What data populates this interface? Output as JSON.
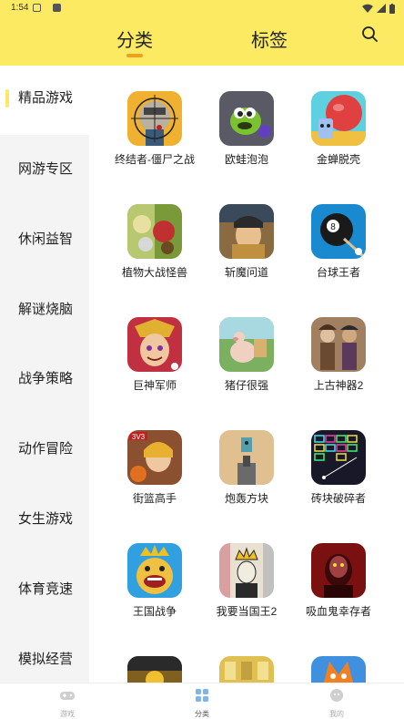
{
  "status": {
    "time": "1:54"
  },
  "header": {
    "tabs": [
      {
        "label": "分类"
      },
      {
        "label": "标签"
      }
    ]
  },
  "sidebar": {
    "items": [
      {
        "label": "精品游戏"
      },
      {
        "label": "网游专区"
      },
      {
        "label": "休闲益智"
      },
      {
        "label": "解谜烧脑"
      },
      {
        "label": "战争策略"
      },
      {
        "label": "动作冒险"
      },
      {
        "label": "女生游戏"
      },
      {
        "label": "体育竞速"
      },
      {
        "label": "模拟经营"
      }
    ]
  },
  "games": [
    {
      "name": "终结者-僵尸之战",
      "icon": "zombie-sniper-icon",
      "color": "#f0b030"
    },
    {
      "name": "欧蛙泡泡",
      "icon": "green-frog-icon",
      "color": "#5a5a66"
    },
    {
      "name": "金蝉脱壳",
      "icon": "ball-run-icon",
      "color": "#5fd0e0"
    },
    {
      "name": "植物大战怪兽",
      "icon": "plants-monsters-icon",
      "color": "#7a9a3a"
    },
    {
      "name": "斩魔问道",
      "icon": "warrior-icon",
      "color": "#8a6a40"
    },
    {
      "name": "台球王者",
      "icon": "billiard-ball-icon",
      "color": "#1a8ad0"
    },
    {
      "name": "巨神军师",
      "icon": "hero-face-icon",
      "color": "#c03040"
    },
    {
      "name": "猪仔很强",
      "icon": "pig-icon",
      "color": "#7ab060"
    },
    {
      "name": "上古神器2",
      "icon": "adventurers-icon",
      "color": "#a08060"
    },
    {
      "name": "街篮高手",
      "icon": "basketball-girl-icon",
      "color": "#8a5030"
    },
    {
      "name": "炮轰方块",
      "icon": "cannon-block-icon",
      "color": "#e0c090"
    },
    {
      "name": "砖块破碎者",
      "icon": "brick-breaker-icon",
      "color": "#181828"
    },
    {
      "name": "王国战争",
      "icon": "king-face-icon",
      "color": "#30a0e0"
    },
    {
      "name": "我要当国王2",
      "icon": "crown-king-icon",
      "color": "#e8e0d0"
    },
    {
      "name": "吸血鬼幸存者",
      "icon": "vampire-icon",
      "color": "#7a1010"
    },
    {
      "name": "",
      "icon": "gold-coins-icon",
      "color": "#806020"
    },
    {
      "name": "",
      "icon": "building-icon",
      "color": "#e0c050"
    },
    {
      "name": "",
      "icon": "fox-icon",
      "color": "#4090e0"
    }
  ],
  "nav": {
    "items": [
      {
        "label": "游戏",
        "icon": "gamepad-icon"
      },
      {
        "label": "分类",
        "icon": "grid-icon"
      },
      {
        "label": "我的",
        "icon": "profile-icon"
      }
    ]
  },
  "colors": {
    "header_bg": "#fcea62",
    "tab_underline": "#f0a020",
    "sidebar_bg": "#f4f4f4",
    "active_nav": "#7fb6e8"
  }
}
